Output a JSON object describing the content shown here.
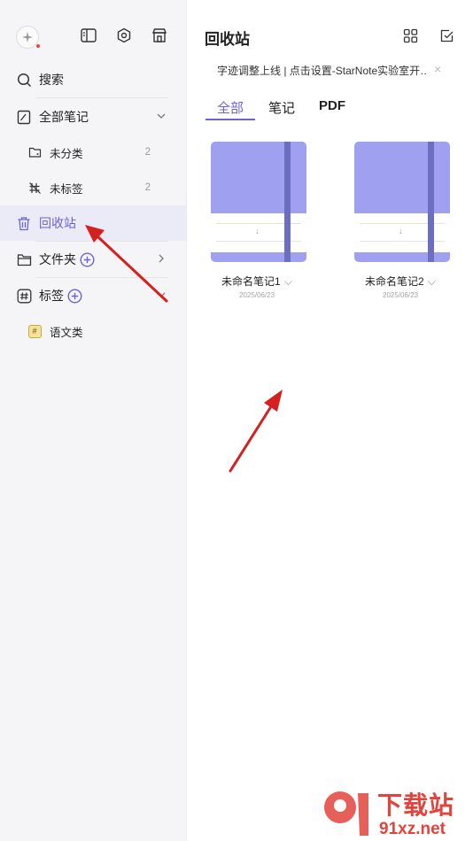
{
  "sidebar": {
    "items": {
      "search": {
        "label": "搜索"
      },
      "all_notes": {
        "label": "全部笔记"
      },
      "uncategorized": {
        "label": "未分类",
        "count": "2"
      },
      "untagged": {
        "label": "未标签",
        "count": "2"
      },
      "trash": {
        "label": "回收站"
      },
      "folders": {
        "label": "文件夹"
      },
      "tags": {
        "label": "标签"
      },
      "tag_chinese": {
        "label": "语文类",
        "glyph": "#"
      }
    },
    "accent_color": "#6b63d8"
  },
  "main": {
    "title": "回收站",
    "banner": "字迹调整上线 | 点击设置-StarNote实验室开…",
    "banner_close": "×",
    "tabs": [
      {
        "label": "全部",
        "active": true
      },
      {
        "label": "笔记",
        "active": false
      },
      {
        "label": "PDF",
        "active": false
      }
    ],
    "notes": [
      {
        "title": "未命名笔记1",
        "date": "2025/06/23",
        "cover_color": "#9fa0ef"
      },
      {
        "title": "未命名笔记2",
        "date": "2025/06/23",
        "cover_color": "#9fa0ef"
      }
    ]
  },
  "watermark": {
    "brand": "下载站",
    "domain": "91xz.net"
  }
}
